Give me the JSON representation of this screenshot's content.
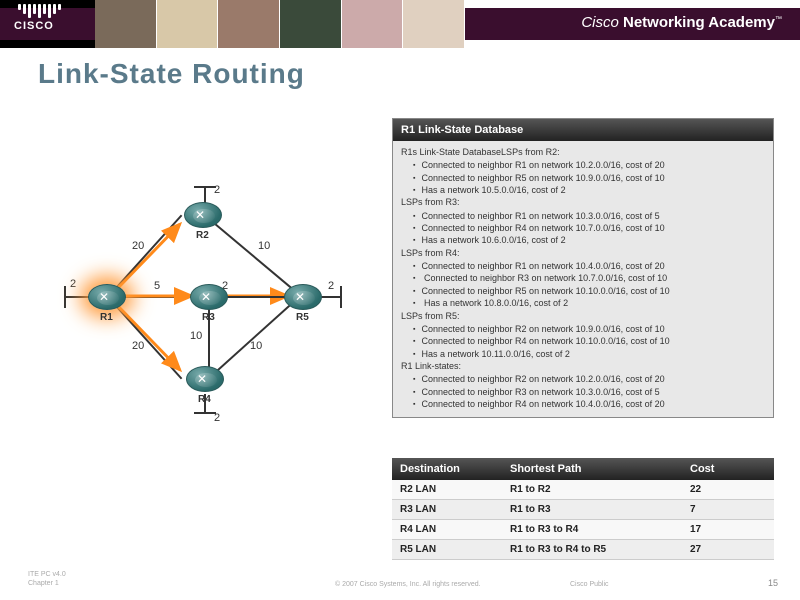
{
  "header": {
    "logo_text": "CISCO",
    "academy": "Cisco Networking Academy",
    "academy_bold": "Networking Academy",
    "academy_prefix": "Cisco "
  },
  "title": "Link-State Routing",
  "diagram": {
    "routers": [
      "R1",
      "R2",
      "R3",
      "R4",
      "R5"
    ],
    "links": [
      {
        "from": "R1",
        "to": "R2",
        "cost": 20
      },
      {
        "from": "R1",
        "to": "R3",
        "cost": 5
      },
      {
        "from": "R1",
        "to": "R4",
        "cost": 20
      },
      {
        "from": "R2",
        "to": "R5",
        "cost": 10
      },
      {
        "from": "R3",
        "to": "R4",
        "cost": 10
      },
      {
        "from": "R4",
        "to": "R5",
        "cost": 10
      }
    ],
    "stubs": {
      "R1": 2,
      "R2": 2,
      "R3": 2,
      "R4": 2,
      "R5": 2
    }
  },
  "panel": {
    "title": "R1 Link-State Database",
    "intro": "R1s Link-State DatabaseLSPs from R2:",
    "groups": [
      {
        "head": "",
        "items": [
          "Connected to neighbor R1 on network 10.2.0.0/16, cost of 20",
          "Connected to neighbor R5 on network 10.9.0.0/16, cost of 10",
          "Has a network 10.5.0.0/16, cost of 2"
        ]
      },
      {
        "head": "LSPs from R3:",
        "items": [
          "Connected to neighbor R1 on network 10.3.0.0/16, cost of 5",
          "Connected to neighbor R4 on network 10.7.0.0/16, cost of 10",
          "Has a network 10.6.0.0/16, cost of 2"
        ]
      },
      {
        "head": "LSPs from R4:",
        "items": [
          "Connected to neighbor R1 on network 10.4.0.0/16, cost of 20",
          " Connected to neighbor R3 on network 10.7.0.0/16, cost of 10",
          "Connected to neighbor R5 on network 10.10.0.0/16, cost of 10",
          " Has a network 10.8.0.0/16, cost of 2"
        ]
      },
      {
        "head": "LSPs from R5:",
        "items": [
          "Connected to neighbor R2 on network 10.9.0.0/16, cost of 10",
          "Connected to neighbor R4 on network 10.10.0.0/16, cost of 10",
          "Has a network 10.11.0.0/16, cost of 2"
        ]
      },
      {
        "head": "R1 Link-states:",
        "items": [
          "Connected to neighbor R2 on network 10.2.0.0/16, cost of 20",
          "Connected to neighbor R3 on network 10.3.0.0/16, cost of 5",
          "Connected to neighbor R4 on network 10.4.0.0/16, cost of 20"
        ]
      }
    ]
  },
  "spt": {
    "headers": [
      "Destination",
      "Shortest Path",
      "Cost"
    ],
    "rows": [
      {
        "dest": "R2 LAN",
        "path": "R1 to R2",
        "cost": "22"
      },
      {
        "dest": "R3 LAN",
        "path": "R1 to R3",
        "cost": "7"
      },
      {
        "dest": "R4 LAN",
        "path": "R1 to R3 to R4",
        "cost": "17"
      },
      {
        "dest": "R5 LAN",
        "path": "R1 to R3 to R4 to R5",
        "cost": "27"
      }
    ]
  },
  "footer": {
    "left1": "ITE PC v4.0",
    "left2": "Chapter 1",
    "mid": "© 2007 Cisco Systems, Inc. All rights reserved.",
    "right": "Cisco Public",
    "slide": "15"
  }
}
